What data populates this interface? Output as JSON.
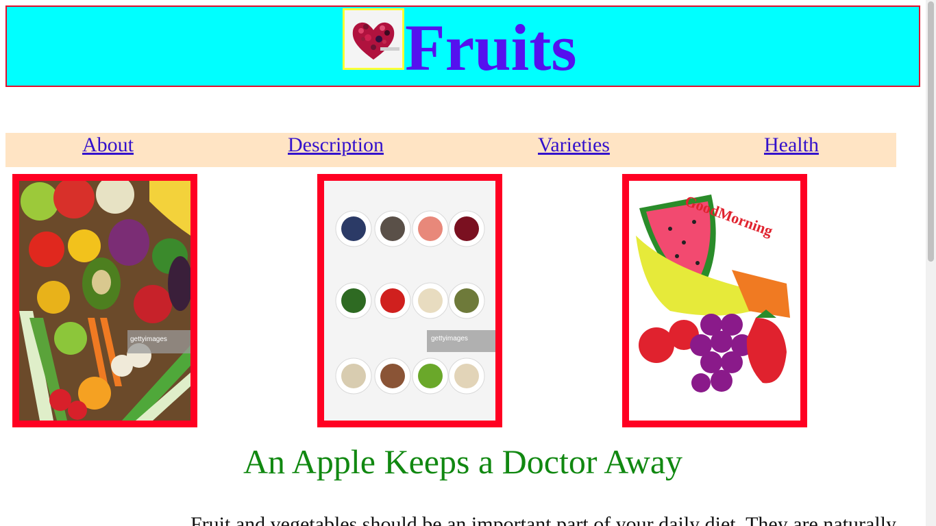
{
  "header": {
    "title": "Fruits",
    "logo_icon": "fruit-heart-icon"
  },
  "nav": {
    "items": [
      {
        "label": "About"
      },
      {
        "label": "Description"
      },
      {
        "label": "Varieties"
      },
      {
        "label": "Health"
      }
    ]
  },
  "gallery": {
    "images": [
      {
        "kind": "fruits-vegetables-photo",
        "watermark": "gettyimages"
      },
      {
        "kind": "bowls-of-seeds-and-fruit-photo",
        "watermark": "gettyimages"
      },
      {
        "kind": "good-morning-fruit-illustration",
        "caption": "GoodMorning"
      }
    ]
  },
  "main": {
    "tagline": "An Apple Keeps a Doctor Away",
    "paragraph": "Fruit and vegetables should be an important part of your daily diet. They are naturally"
  },
  "colors": {
    "header_bg": "#00ffff",
    "title": "#5511ee",
    "nav_bg": "#ffe4c4",
    "card_border": "#ff0022",
    "tagline": "#118811"
  }
}
